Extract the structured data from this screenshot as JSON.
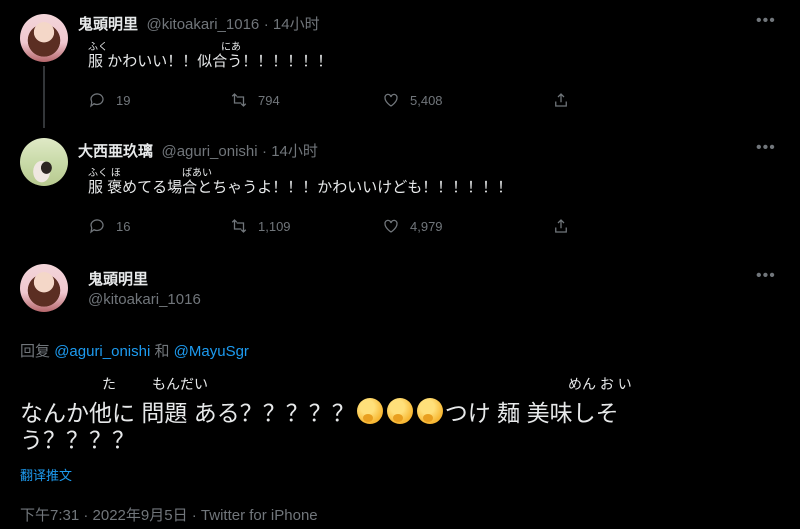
{
  "tweet1": {
    "name": "鬼頭明里",
    "handle": "@kitoakari_1016",
    "time": "· 14小时",
    "text_a": "服",
    "text_b": "かわいい！！",
    "text_c": "似合う！！！！！！",
    "furi_a": "ふく",
    "furi_c": "にあ",
    "replies": "19",
    "retweets": "794",
    "likes": "5,408"
  },
  "tweet2": {
    "name": "大西亜玖璃",
    "handle": "@aguri_onishi",
    "time": "· 14小时",
    "text_a": "服 褒めてる",
    "text_b": "場合",
    "text_c": "とちゃうよ！！！かわいいけども！！！！！！",
    "furi_a": "ふく ほ",
    "furi_b": "ばあい",
    "replies": "16",
    "retweets": "1,109",
    "likes": "4,979"
  },
  "main": {
    "name": "鬼頭明里",
    "handle": "@kitoakari_1016",
    "reply_prefix": "回复",
    "reply_to_1": "@aguri_onishi",
    "reply_and": "和",
    "reply_to_2": "@MayuSgr",
    "text_1": "なんか",
    "text_2": "他に",
    "text_3": "問題",
    "text_4": "ある？？？？？",
    "text_5": "つけ",
    "text_6": "麺",
    "text_7": "美味しそ",
    "text_8": "う？？？？",
    "furi_ta": "た",
    "furi_mondai": "もんだい",
    "furi_menoi": "めん お い",
    "translate": "翻译推文",
    "timestamp": "下午7:31 · 2022年9月5日 · Twitter for iPhone"
  },
  "icons": [
    "more-icon",
    "reply-icon",
    "retweet-icon",
    "like-icon",
    "share-icon",
    "thinking-face-emoji"
  ]
}
